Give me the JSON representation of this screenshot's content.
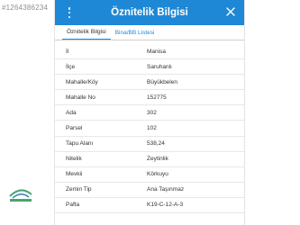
{
  "watermark": {
    "listing_id": "#1264386234"
  },
  "appbar": {
    "title": "Öznitelik Bilgisi",
    "menu_icon": "more-vertical-icon",
    "close_icon": "close-icon"
  },
  "tabs": [
    {
      "label": "Öznitelik Bilgisi",
      "active": true
    },
    {
      "label": "Bina/BB Listesi",
      "active": false
    }
  ],
  "attributes": [
    {
      "label": "İl",
      "value": "Manisa"
    },
    {
      "label": "İlçe",
      "value": "Saruhanlı"
    },
    {
      "label": "Mahalle/Köy",
      "value": "Büyükbelen"
    },
    {
      "label": "Mahalle No",
      "value": "152775"
    },
    {
      "label": "Ada",
      "value": "302"
    },
    {
      "label": "Parsel",
      "value": "102"
    },
    {
      "label": "Tapu Alanı",
      "value": "538,24"
    },
    {
      "label": "Nitelik",
      "value": "Zeytinlik"
    },
    {
      "label": "Mevkii",
      "value": "Körkuyu"
    },
    {
      "label": "Zemin Tip",
      "value": "Ana Taşınmaz"
    },
    {
      "label": "Pafta",
      "value": "K19-C-12-A-3"
    }
  ],
  "logo": {
    "brand_color": "#4aa56f"
  },
  "colors": {
    "accent": "#1f88d6"
  }
}
